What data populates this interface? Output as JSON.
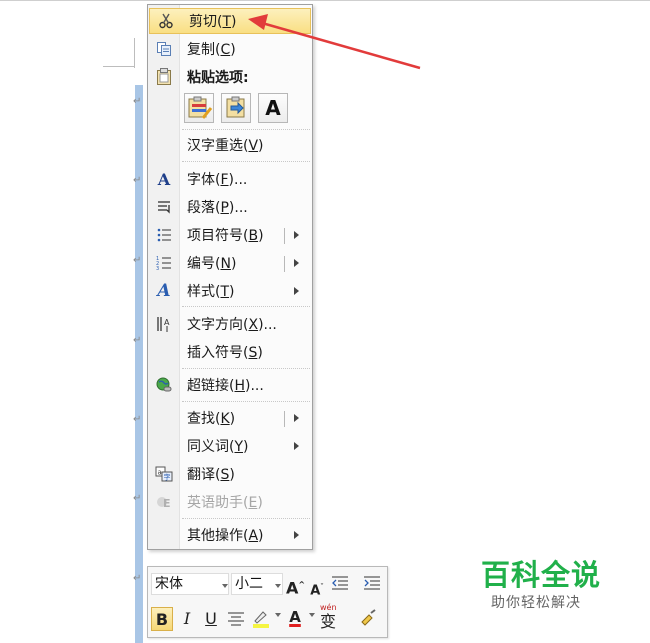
{
  "context_menu": {
    "items": [
      {
        "label": "剪切(",
        "key": "T",
        "tail": ")",
        "icon": "scissors-icon",
        "highlighted": true
      },
      {
        "label": "复制(",
        "key": "C",
        "tail": ")",
        "icon": "copy-icon"
      },
      {
        "label": "粘贴选项:",
        "icon": "clipboard-icon"
      },
      {
        "label": "汉字重选(",
        "key": "V",
        "tail": ")"
      },
      {
        "label": "字体(",
        "key": "F",
        "tail": ")..."
      },
      {
        "label": "段落(",
        "key": "P",
        "tail": ")..."
      },
      {
        "label": "项目符号(",
        "key": "B",
        "tail": ")"
      },
      {
        "label": "编号(",
        "key": "N",
        "tail": ")"
      },
      {
        "label": "样式(",
        "key": "T",
        "tail": ")"
      },
      {
        "label": "文字方向(",
        "key": "X",
        "tail": ")..."
      },
      {
        "label": "插入符号(",
        "key": "S",
        "tail": ")"
      },
      {
        "label": "超链接(",
        "key": "H",
        "tail": ")..."
      },
      {
        "label": "查找(",
        "key": "K",
        "tail": ")"
      },
      {
        "label": "同义词(",
        "key": "Y",
        "tail": ")"
      },
      {
        "label": "翻译(",
        "key": "S",
        "tail": ")"
      },
      {
        "label": "英语助手(",
        "key": "E",
        "tail": ")",
        "disabled": true
      },
      {
        "label": "其他操作(",
        "key": "A",
        "tail": ")"
      }
    ],
    "paste_options": [
      "keep-source-formatting",
      "merge-formatting",
      "keep-text-only"
    ],
    "paste_text_only_glyph": "A"
  },
  "mini_toolbar": {
    "font_name": "宋体",
    "font_size": "小二",
    "bold": "B",
    "italic": "I",
    "underline": "U",
    "grow_font": "A",
    "shrink_font": "A",
    "font_color_glyph": "A",
    "phonetic_glyph": "变",
    "phonetic_top": "wén"
  },
  "watermark": {
    "title": "百科全说",
    "subtitle": "助你轻松解决"
  },
  "colors": {
    "highlight": "#f9df83",
    "arrow": "#e23b3b",
    "brand_green": "#20b04a",
    "doc_bar": "#a9c6e6"
  }
}
